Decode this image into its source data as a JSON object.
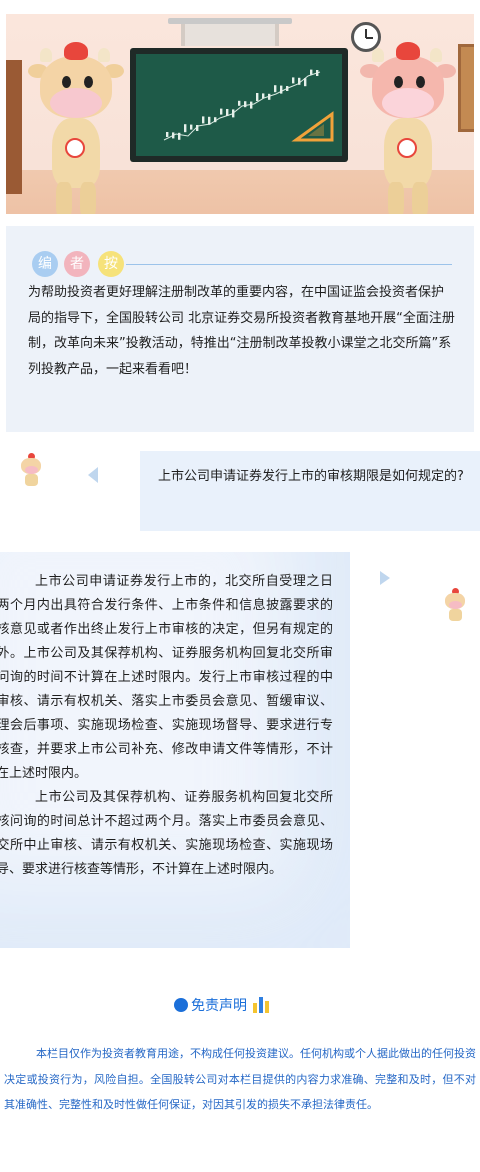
{
  "banner": {
    "alt": ""
  },
  "note": {
    "circles": [
      "编",
      "者",
      "按"
    ],
    "text": "为帮助投资者更好理解注册制改革的重要内容，在中国证监会投资者保护局的指导下，全国股转公司 北京证券交易所投资者教育基地开展“全面注册制，改革向未来”投教活动，特推出“注册制改革投教小课堂之北交所篇”系列投教产品，一起来看看吧！"
  },
  "question": {
    "text": "上市公司申请证券发行上市的审核期限是如何规定的?"
  },
  "answer": {
    "paragraphs": [
      "上市公司申请证券发行上市的，北交所自受理之日起两个月内出具符合发行条件、上市条件和信息披露要求的审核意见或者作出终止发行上市审核的决定，但另有规定的除外。上市公司及其保荐机构、证券服务机构回复北交所审核问询的时间不计算在上述时限内。发行上市审核过程的中止审核、请示有权机关、落实上市委员会意见、暂缓审议、处理会后事项、实施现场检查、实施现场督导、要求进行专项核查，并要求上市公司补充、修改申请文件等情形，不计算在上述时限内。",
      "上市公司及其保荐机构、证券服务机构回复北交所审核问询的时间总计不超过两个月。落实上市委员会意见、北交所中止审核、请示有权机关、实施现场检查、实施现场督导、要求进行核查等情形，不计算在上述时限内。"
    ]
  },
  "disclaimer": {
    "title": "免责声明",
    "text": "本栏目仅作为投资者教育用途，不构成任何投资建议。任何机构或个人据此做出的任何投资决定或投资行为，风险自担。全国股转公司对本栏目提供的内容力求准确、完整和及时，但不对其准确性、完整性和及时性做任何保证，对因其引发的损失不承担法律责任。"
  },
  "colors": {
    "accent_blue": "#1b6fd9",
    "disclaimer_text": "#2668c6",
    "note_bg": "#edf2f9",
    "question_bg": "#e9f1fb",
    "answer_bg": "#f1f5fc",
    "circle_1": "#a9cdf1",
    "circle_2": "#f2b4bd",
    "circle_3": "#f6e27a",
    "bars": [
      "#f4c430",
      "#2f7fe0",
      "#f4c430"
    ]
  }
}
